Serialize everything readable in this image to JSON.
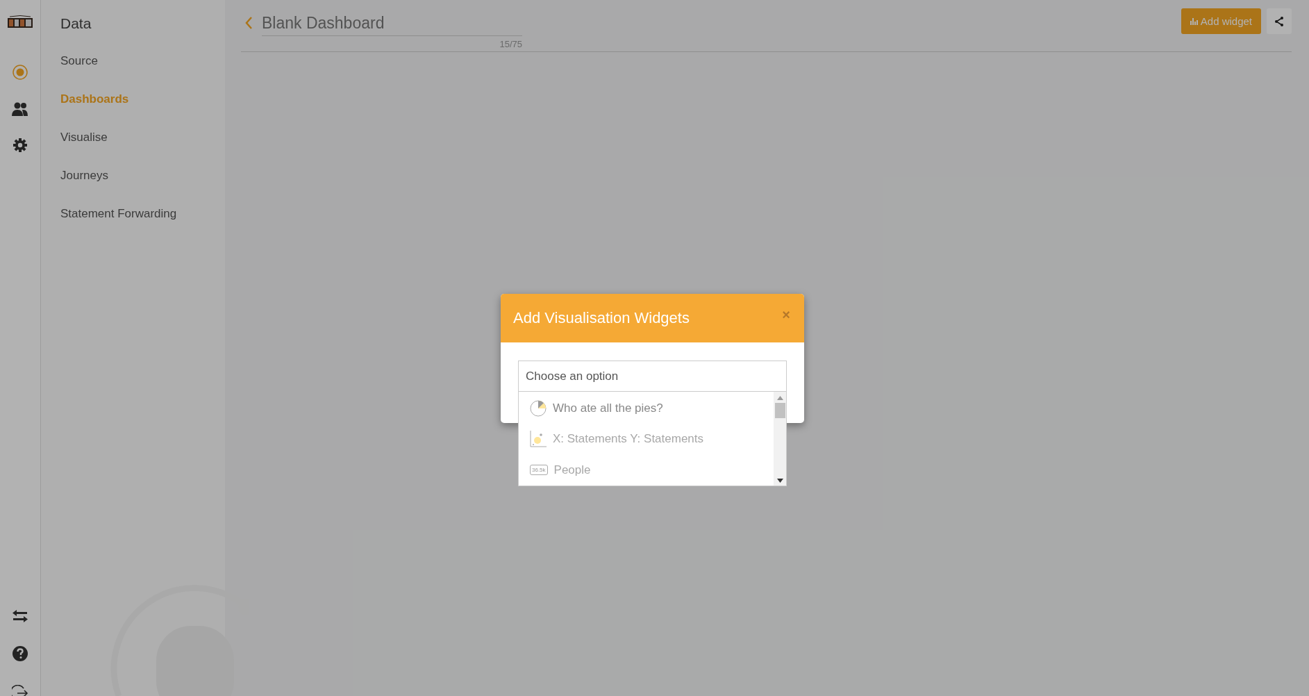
{
  "rail": {
    "top": [
      {
        "kind": "source",
        "selected": true
      },
      {
        "kind": "people",
        "selected": false
      },
      {
        "kind": "settings",
        "selected": false
      }
    ],
    "bottom": [
      {
        "kind": "swap"
      },
      {
        "kind": "help"
      },
      {
        "kind": "logout"
      }
    ]
  },
  "sidebar": {
    "title": "Data",
    "items": [
      {
        "label": "Source",
        "selected": false
      },
      {
        "label": "Dashboards",
        "selected": true
      },
      {
        "label": "Visualise",
        "selected": false
      },
      {
        "label": "Journeys",
        "selected": false
      },
      {
        "label": "Statement Forwarding",
        "selected": false
      }
    ]
  },
  "header": {
    "title": "Blank Dashboard",
    "counter": "15/75",
    "add_button": "Add widget"
  },
  "modal": {
    "title": "Add Visualisation Widgets",
    "close": "×",
    "select": {
      "placeholder": "Choose an option",
      "options": [
        {
          "kind": "pie",
          "label": "Who ate all the pies?",
          "disabled": false
        },
        {
          "kind": "scatter",
          "label": "X: Statements Y: Statements",
          "disabled": true
        },
        {
          "kind": "counter",
          "label": "People",
          "disabled": true,
          "badge": "36.5k"
        }
      ]
    }
  }
}
